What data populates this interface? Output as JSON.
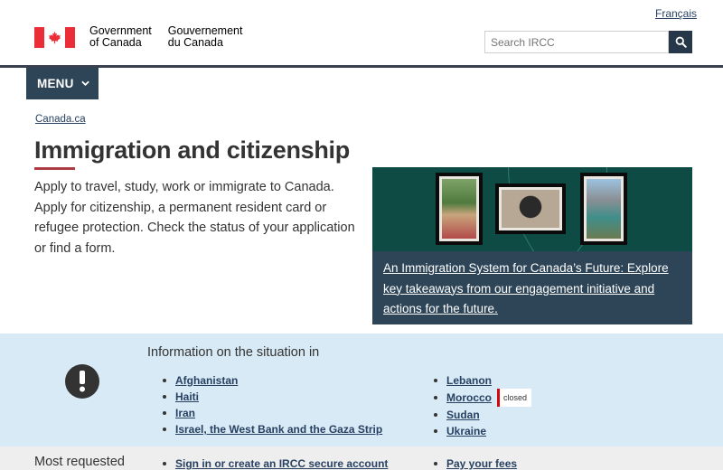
{
  "header": {
    "language_toggle": "Français",
    "signature_en": [
      "Government",
      "of Canada"
    ],
    "signature_fr": [
      "Gouvernement",
      "du Canada"
    ],
    "search_placeholder": "Search IRCC",
    "menu_label": "MENU"
  },
  "breadcrumb": {
    "home": "Canada.ca"
  },
  "page": {
    "title": "Immigration and citizenship",
    "intro": "Apply to travel, study, work or immigrate to Canada. Apply for citizenship, a permanent resident card or refugee protection. Check the status of your application or find a form."
  },
  "feature": {
    "link_text": "An Immigration System for Canada’s Future: Explore key takeaways from our engagement initiative and actions for the future."
  },
  "alert": {
    "heading": "Information on the situation in",
    "left_items": [
      "Afghanistan",
      "Haiti",
      "Iran",
      "Israel, the West Bank and the Gaza Strip"
    ],
    "right_items": [
      {
        "label": "Lebanon",
        "badge": ""
      },
      {
        "label": "Morocco",
        "badge": "closed"
      },
      {
        "label": "Sudan",
        "badge": ""
      },
      {
        "label": "Ukraine",
        "badge": ""
      }
    ]
  },
  "most_requested": {
    "heading": "Most requested",
    "left_items": [
      "Sign in or create an IRCC secure account"
    ],
    "right_items": [
      "Pay your fees"
    ]
  },
  "colors": {
    "accent_red": "#af3c43",
    "nav_blue": "#2e4558",
    "alert_background": "#d7eaf5",
    "badge_red": "#d3080c"
  },
  "icons": {
    "search": "search-icon",
    "menu_chevron": "chevron-down-icon",
    "alert": "exclamation-icon",
    "flag": "canada-flag-icon"
  }
}
